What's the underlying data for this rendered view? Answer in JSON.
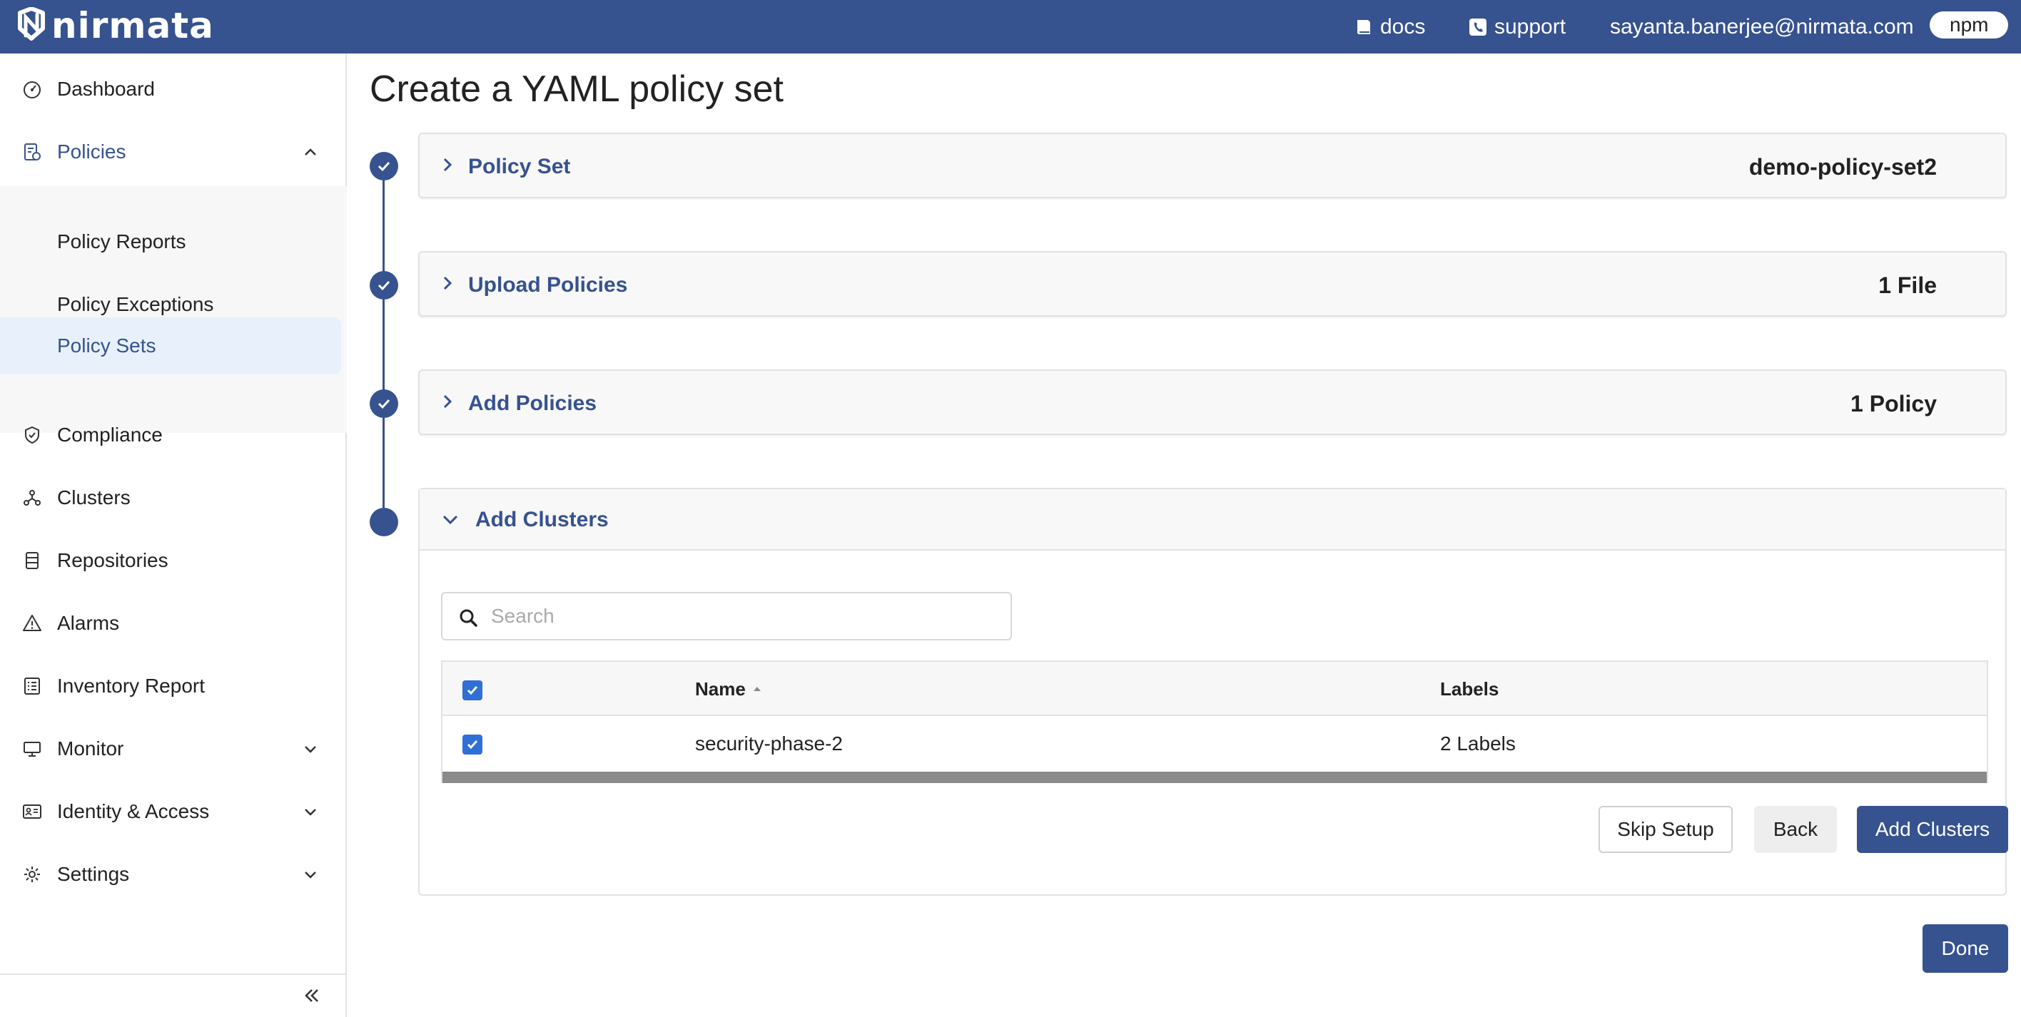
{
  "brand": {
    "name": "nirmata"
  },
  "topnav": {
    "docs": "docs",
    "support": "support",
    "user_email": "sayanta.banerjee@nirmata.com",
    "org_pill": "npm"
  },
  "sidebar": {
    "items": [
      {
        "label": "Dashboard",
        "icon": "dashboard-icon"
      },
      {
        "label": "Policies",
        "icon": "policies-icon",
        "expanded": true
      },
      {
        "label": "Compliance",
        "icon": "shield-check-icon"
      },
      {
        "label": "Clusters",
        "icon": "clusters-icon"
      },
      {
        "label": "Repositories",
        "icon": "repositories-icon"
      },
      {
        "label": "Alarms",
        "icon": "warning-icon"
      },
      {
        "label": "Inventory Report",
        "icon": "list-icon"
      },
      {
        "label": "Monitor",
        "icon": "monitor-icon",
        "expandable": true
      },
      {
        "label": "Identity & Access",
        "icon": "id-card-icon",
        "expandable": true
      },
      {
        "label": "Settings",
        "icon": "gear-icon",
        "expandable": true
      }
    ],
    "policies_children": [
      {
        "label": "Policy Reports"
      },
      {
        "label": "Policy Exceptions"
      },
      {
        "label": "Policy Sets",
        "selected": true
      }
    ]
  },
  "main": {
    "title": "Create a YAML policy set",
    "steps": [
      {
        "title": "Policy Set",
        "value": "demo-policy-set2",
        "complete": true
      },
      {
        "title": "Upload Policies",
        "value": "1 File",
        "complete": true
      },
      {
        "title": "Add Policies",
        "value": "1 Policy",
        "complete": true
      },
      {
        "title": "Add Clusters",
        "complete": false,
        "expanded": true
      }
    ],
    "search": {
      "placeholder": "Search",
      "value": ""
    },
    "table": {
      "columns": [
        "Name",
        "Labels"
      ],
      "sort": {
        "column": "Name",
        "direction": "asc"
      },
      "rows": [
        {
          "checked": true,
          "name": "security-phase-2",
          "labels": "2 Labels"
        }
      ],
      "select_all_checked": true
    },
    "buttons": {
      "skip": "Skip Setup",
      "back": "Back",
      "add_clusters": "Add Clusters",
      "done": "Done"
    }
  },
  "colors": {
    "brand": "#36528f",
    "checkbox": "#2f6fd6",
    "selected_bg": "#e8f1fb"
  }
}
